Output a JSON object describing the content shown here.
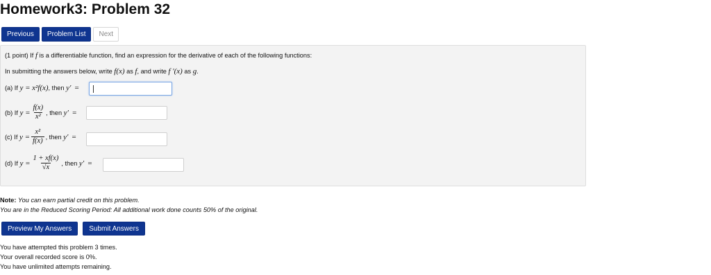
{
  "title": "Homework3: Problem 32",
  "nav": {
    "previous": "Previous",
    "problem_list": "Problem List",
    "next": "Next"
  },
  "problem": {
    "intro_prefix": "(1 point) If",
    "intro_f": "f",
    "intro_suffix": "is a differentiable function, find an expression for the derivative of each of the following functions:",
    "instr_prefix": "In submitting the answers below, write",
    "instr_fx": "f(x)",
    "instr_as1": "as",
    "instr_f": "f",
    "instr_mid": ", and write",
    "instr_fpx": "f ′(x)",
    "instr_as2": "as",
    "instr_g": "g",
    "instr_end": ".",
    "parts": [
      {
        "label": "(a) If",
        "lhs": "y =",
        "expr": "x²f(x)",
        "then": ", then",
        "yprime": "y′",
        "eq": "=",
        "answer": ""
      },
      {
        "label": "(b) If",
        "lhs": "y =",
        "num": "f(x)",
        "den": "x²",
        "then": ", then",
        "yprime": "y′",
        "eq": "=",
        "answer": ""
      },
      {
        "label": "(c) If",
        "lhs": "y =",
        "num": "x²",
        "den": "f(x)",
        "then": ", then",
        "yprime": "y′",
        "eq": "=",
        "answer": ""
      },
      {
        "label": "(d) If",
        "lhs": "y =",
        "num": "1 + xf(x)",
        "den": "√x",
        "then": ", then",
        "yprime": "y′",
        "eq": "=",
        "answer": ""
      }
    ]
  },
  "note": {
    "label": "Note:",
    "text": "You can earn partial credit on this problem.",
    "reduced": "You are in the Reduced Scoring Period: All additional work done counts 50% of the original."
  },
  "actions": {
    "preview": "Preview My Answers",
    "submit": "Submit Answers"
  },
  "status": {
    "attempts": "You have attempted this problem 3 times.",
    "score": "Your overall recorded score is 0%.",
    "remaining": "You have unlimited attempts remaining."
  },
  "colors": {
    "button_bg": "#0f3590",
    "box_bg": "#f3f3f3",
    "focus_border": "#7aa6e3"
  }
}
